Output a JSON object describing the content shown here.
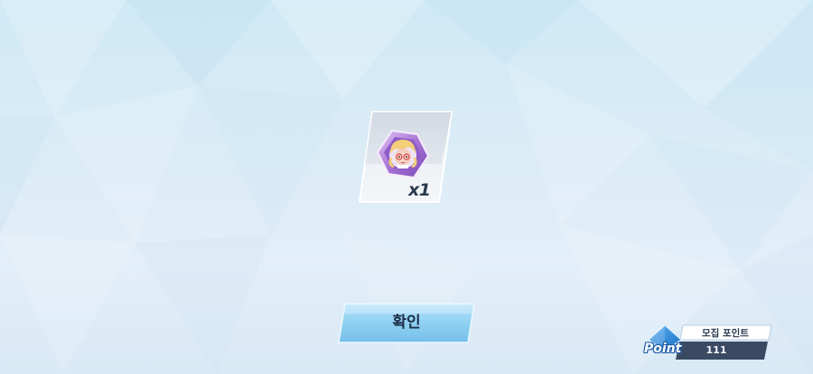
{
  "reward": {
    "icon": "character-portrait-token-icon",
    "quantity": "x1"
  },
  "confirm": {
    "label": "확인"
  },
  "recruit_points": {
    "badge_word": "Point",
    "title": "모집 포인트",
    "value": "111"
  },
  "colors": {
    "background_top": "#cfe9f6",
    "background_bottom": "#e3eef8",
    "button_fill": "#8fd0f2",
    "hexagon_accent": "#b07ad6",
    "point_badge": "#2a8be0"
  }
}
